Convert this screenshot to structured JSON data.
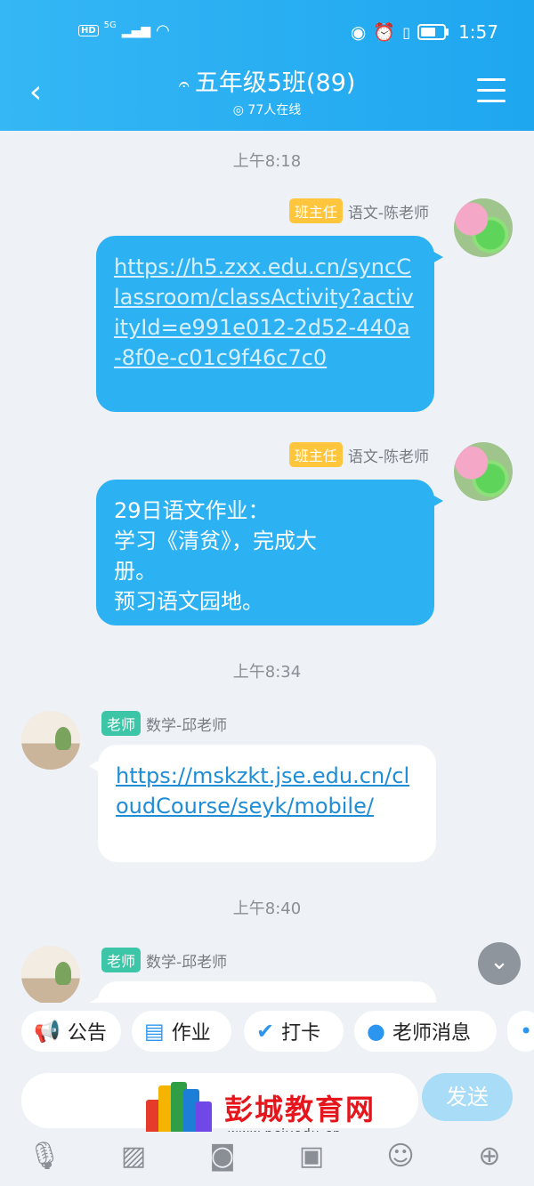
{
  "status_bar": {
    "network": "5G",
    "hd": "HD",
    "time": "1:57"
  },
  "header": {
    "title": "五年级5班(89)",
    "online": "77人在线"
  },
  "messages": [
    {
      "time": "上午8:18"
    },
    {
      "role_tag": "班主任",
      "sender": "语文-陈老师",
      "text": "https://h5.zxx.edu.cn/syncClassroom/classActivity?activityId=e991e012-2d52-440a-8f0e-c01c9f46c7c0",
      "is_link": true
    },
    {
      "role_tag": "班主任",
      "sender": "语文-陈老师",
      "lines": [
        "29日语文作业：",
        "学习《清贫》，完成大",
        "册。",
        "预习语文园地。"
      ]
    },
    {
      "time": "上午8:34"
    },
    {
      "role_tag": "老师",
      "sender": "数学-邱老师",
      "text": "https://mskzkt.jse.edu.cn/cloudCourse/seyk/mobile/",
      "is_link": true
    },
    {
      "time": "上午8:40"
    },
    {
      "role_tag": "老师",
      "sender": "数学-邱老师"
    }
  ],
  "quick_actions": [
    {
      "label": "公告",
      "icon": "megaphone-icon"
    },
    {
      "label": "作业",
      "icon": "document-icon"
    },
    {
      "label": "打卡",
      "icon": "check-circle-icon"
    },
    {
      "label": "老师消息",
      "icon": "chat-icon"
    }
  ],
  "input": {
    "send_label": "发送"
  },
  "watermark": {
    "text": "彭城教育网",
    "url": "www.pcjyedu.cn"
  },
  "toolbar": [
    "microphone-icon",
    "image-icon",
    "camera-icon",
    "gift-icon",
    "emoji-icon",
    "plus-icon"
  ],
  "colors": {
    "header": "#1ea6ef",
    "bubble_blue": "#2cb2f2",
    "tag_orange": "#ffc63d",
    "tag_green": "#3cc5a6"
  }
}
